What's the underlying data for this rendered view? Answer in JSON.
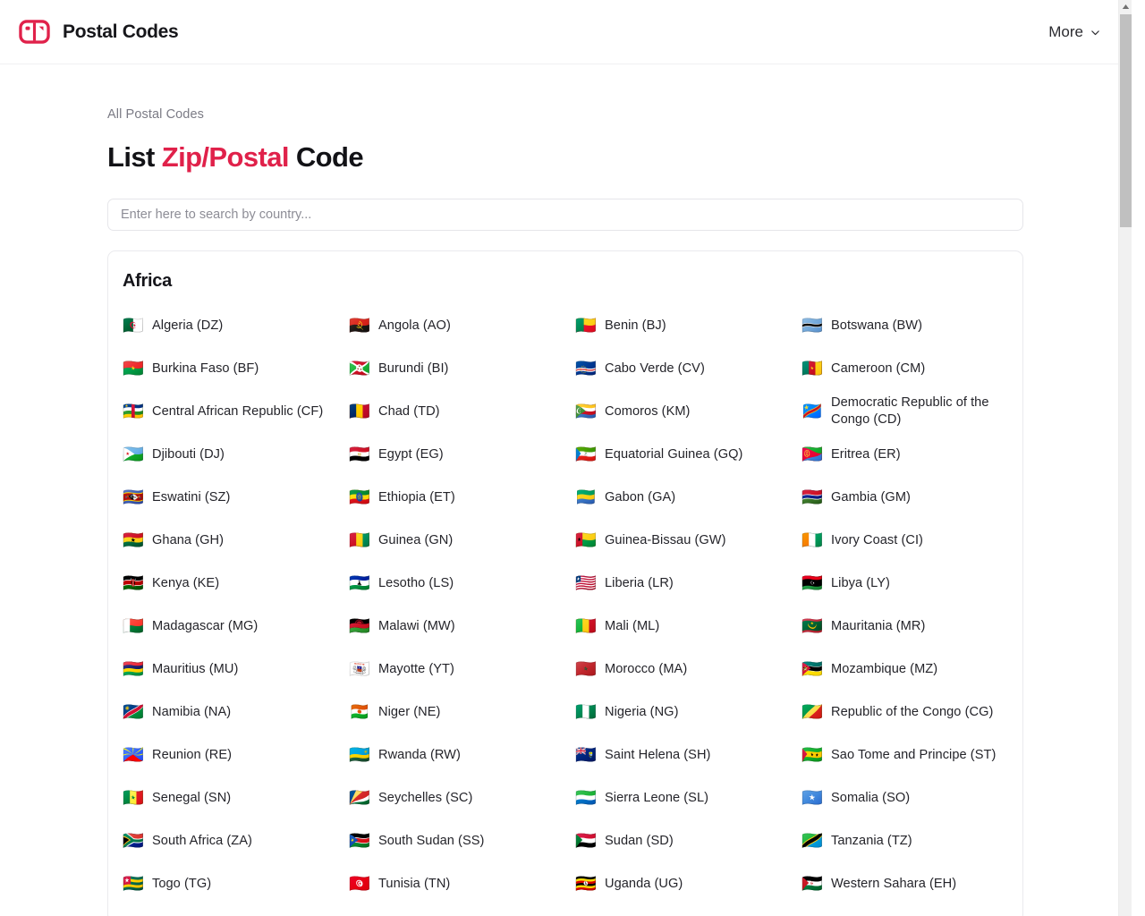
{
  "header": {
    "brand_name": "Postal Codes",
    "logo_icon": "mailbox-icon",
    "accent_color": "#e0214a",
    "nav": {
      "more_label": "More",
      "more_icon": "chevron-down-icon"
    }
  },
  "main": {
    "breadcrumb": "All Postal Codes",
    "title": {
      "prefix": "List ",
      "accent": "Zip/Postal",
      "suffix": " Code"
    },
    "search": {
      "placeholder": "Enter here to search by country...",
      "value": ""
    }
  },
  "region": {
    "name": "Africa",
    "countries": [
      {
        "flag": "🇩🇿",
        "label": "Algeria (DZ)"
      },
      {
        "flag": "🇦🇴",
        "label": "Angola (AO)"
      },
      {
        "flag": "🇧🇯",
        "label": "Benin (BJ)"
      },
      {
        "flag": "🇧🇼",
        "label": "Botswana (BW)"
      },
      {
        "flag": "🇧🇫",
        "label": "Burkina Faso (BF)"
      },
      {
        "flag": "🇧🇮",
        "label": "Burundi (BI)"
      },
      {
        "flag": "🇨🇻",
        "label": "Cabo Verde (CV)"
      },
      {
        "flag": "🇨🇲",
        "label": "Cameroon (CM)"
      },
      {
        "flag": "🇨🇫",
        "label": "Central African Republic (CF)"
      },
      {
        "flag": "🇹🇩",
        "label": "Chad (TD)"
      },
      {
        "flag": "🇰🇲",
        "label": "Comoros (KM)"
      },
      {
        "flag": "🇨🇩",
        "label": "Democratic Republic of the Congo (CD)"
      },
      {
        "flag": "🇩🇯",
        "label": "Djibouti (DJ)"
      },
      {
        "flag": "🇪🇬",
        "label": "Egypt (EG)"
      },
      {
        "flag": "🇬🇶",
        "label": "Equatorial Guinea (GQ)"
      },
      {
        "flag": "🇪🇷",
        "label": "Eritrea (ER)"
      },
      {
        "flag": "🇸🇿",
        "label": "Eswatini (SZ)"
      },
      {
        "flag": "🇪🇹",
        "label": "Ethiopia (ET)"
      },
      {
        "flag": "🇬🇦",
        "label": "Gabon (GA)"
      },
      {
        "flag": "🇬🇲",
        "label": "Gambia (GM)"
      },
      {
        "flag": "🇬🇭",
        "label": "Ghana (GH)"
      },
      {
        "flag": "🇬🇳",
        "label": "Guinea (GN)"
      },
      {
        "flag": "🇬🇼",
        "label": "Guinea-Bissau (GW)"
      },
      {
        "flag": "🇨🇮",
        "label": "Ivory Coast (CI)"
      },
      {
        "flag": "🇰🇪",
        "label": "Kenya (KE)"
      },
      {
        "flag": "🇱🇸",
        "label": "Lesotho (LS)"
      },
      {
        "flag": "🇱🇷",
        "label": "Liberia (LR)"
      },
      {
        "flag": "🇱🇾",
        "label": "Libya (LY)"
      },
      {
        "flag": "🇲🇬",
        "label": "Madagascar (MG)"
      },
      {
        "flag": "🇲🇼",
        "label": "Malawi (MW)"
      },
      {
        "flag": "🇲🇱",
        "label": "Mali (ML)"
      },
      {
        "flag": "🇲🇷",
        "label": "Mauritania (MR)"
      },
      {
        "flag": "🇲🇺",
        "label": "Mauritius (MU)"
      },
      {
        "flag": "🇾🇹",
        "label": "Mayotte (YT)"
      },
      {
        "flag": "🇲🇦",
        "label": "Morocco (MA)"
      },
      {
        "flag": "🇲🇿",
        "label": "Mozambique (MZ)"
      },
      {
        "flag": "🇳🇦",
        "label": "Namibia (NA)"
      },
      {
        "flag": "🇳🇪",
        "label": "Niger (NE)"
      },
      {
        "flag": "🇳🇬",
        "label": "Nigeria (NG)"
      },
      {
        "flag": "🇨🇬",
        "label": "Republic of the Congo (CG)"
      },
      {
        "flag": "🇷🇪",
        "label": "Reunion (RE)"
      },
      {
        "flag": "🇷🇼",
        "label": "Rwanda (RW)"
      },
      {
        "flag": "🇸🇭",
        "label": "Saint Helena (SH)"
      },
      {
        "flag": "🇸🇹",
        "label": "Sao Tome and Principe (ST)"
      },
      {
        "flag": "🇸🇳",
        "label": "Senegal (SN)"
      },
      {
        "flag": "🇸🇨",
        "label": "Seychelles (SC)"
      },
      {
        "flag": "🇸🇱",
        "label": "Sierra Leone (SL)"
      },
      {
        "flag": "🇸🇴",
        "label": "Somalia (SO)"
      },
      {
        "flag": "🇿🇦",
        "label": "South Africa (ZA)"
      },
      {
        "flag": "🇸🇸",
        "label": "South Sudan (SS)"
      },
      {
        "flag": "🇸🇩",
        "label": "Sudan (SD)"
      },
      {
        "flag": "🇹🇿",
        "label": "Tanzania (TZ)"
      },
      {
        "flag": "🇹🇬",
        "label": "Togo (TG)"
      },
      {
        "flag": "🇹🇳",
        "label": "Tunisia (TN)"
      },
      {
        "flag": "🇺🇬",
        "label": "Uganda (UG)"
      },
      {
        "flag": "🇪🇭",
        "label": "Western Sahara (EH)"
      }
    ]
  },
  "scrollbar": {
    "up_arrow_icon": "scroll-up-arrow-icon"
  }
}
